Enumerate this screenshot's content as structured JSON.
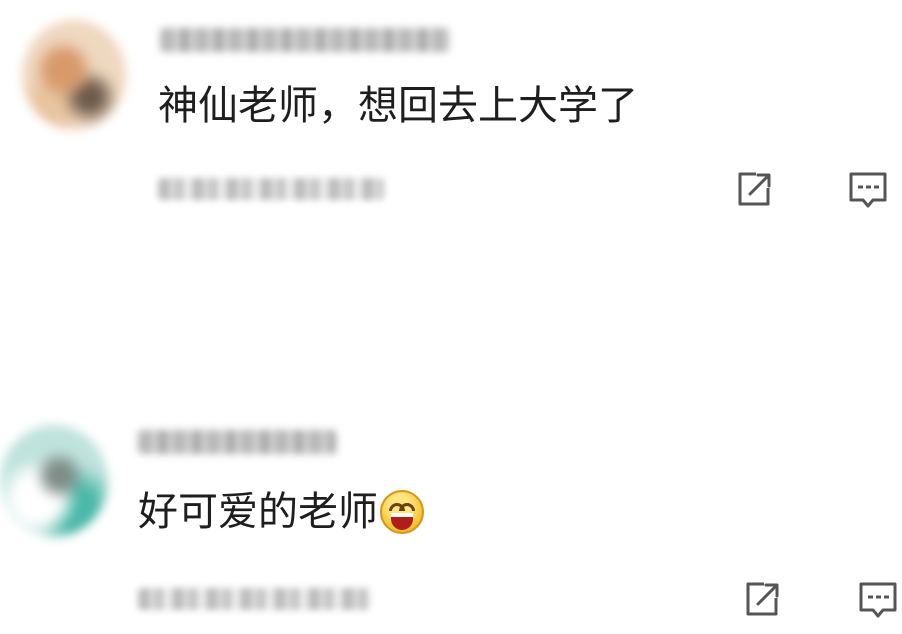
{
  "comments": [
    {
      "text": "神仙老师，想回去上大学了",
      "emoji": null,
      "username_blurred": true,
      "timestamp_blurred": true,
      "actions": [
        "share-icon",
        "reply-icon"
      ]
    },
    {
      "text": "好可爱的老师",
      "emoji": "grinning-face-emoji",
      "username_blurred": true,
      "timestamp_blurred": true,
      "actions": [
        "share-icon",
        "reply-icon"
      ]
    }
  ],
  "colors": {
    "text": "#1e1e1e",
    "icon": "#555555",
    "background": "#ffffff"
  }
}
